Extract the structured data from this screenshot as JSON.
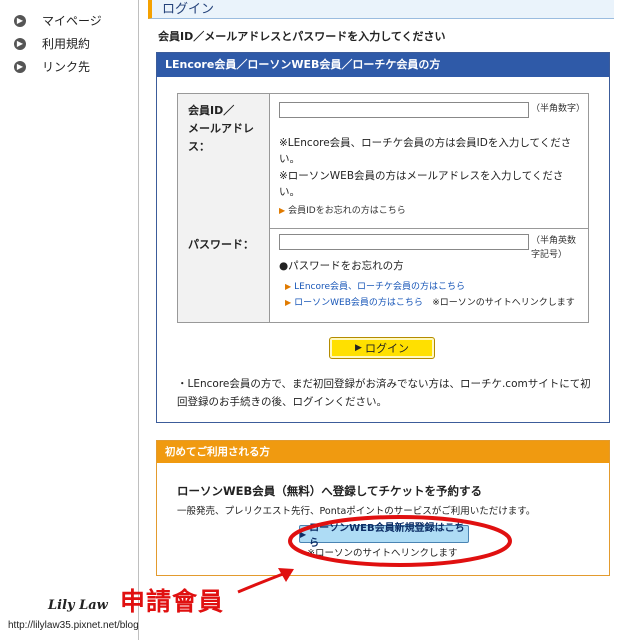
{
  "sidebar": {
    "items": [
      {
        "label": "マイページ"
      },
      {
        "label": "利用規約"
      },
      {
        "label": "リンク先"
      }
    ]
  },
  "page": {
    "title": "ログイン",
    "instruction": "会員ID／メールアドレスとパスワードを入力してください"
  },
  "login_box": {
    "header": "LEncore会員／ローソンWEB会員／ローチケ会員の方",
    "id_field": {
      "label_lines": [
        "会員ID／",
        "メールアドレ",
        "ス："
      ],
      "value": "",
      "hint": "（半角数字）",
      "notes": [
        "※LEncore会員、ローチケ会員の方は会員IDを入力してください。",
        "※ローソンWEB会員の方はメールアドレスを入力してください。"
      ],
      "forgot_link": "会員IDをお忘れの方はこちら"
    },
    "password_field": {
      "label": "パスワード：",
      "value": "",
      "hint": "（半角英数字記号）",
      "forgot_heading": "●パスワードをお忘れの方",
      "link_lencore": "LEncore会員、ローチケ会員の方はこちら",
      "link_lawson": "ローソンWEB会員の方はこちら",
      "link_lawson_note": "※ローソンのサイトへリンクします"
    },
    "login_button": "ログイン",
    "footer_note": "・LEncore会員の方で、まだ初回登録がお済みでない方は、ローチケ.comサイトにて初回登録のお手続きの後、ログインください。"
  },
  "first_box": {
    "header": "初めてご利用される方",
    "title": "ローソンWEB会員（無料）へ登録してチケットを予約する",
    "subtitle": "一般発売、プレリクエスト先行、Pontaポイントのサービスがご利用いただけます。",
    "register_button": "ローソンWEB会員新規登録はこちら",
    "register_note": "※ローソンのサイトへリンクします"
  },
  "annotation": {
    "handwriting": "申請會員",
    "signature": "Lily Law",
    "url": "http://lilylaw35.pixnet.net/blog"
  },
  "colors": {
    "login_header": "#2f5aa8",
    "first_header": "#f09a10",
    "login_button": "#ffe000",
    "annotation_red": "#e01010"
  }
}
